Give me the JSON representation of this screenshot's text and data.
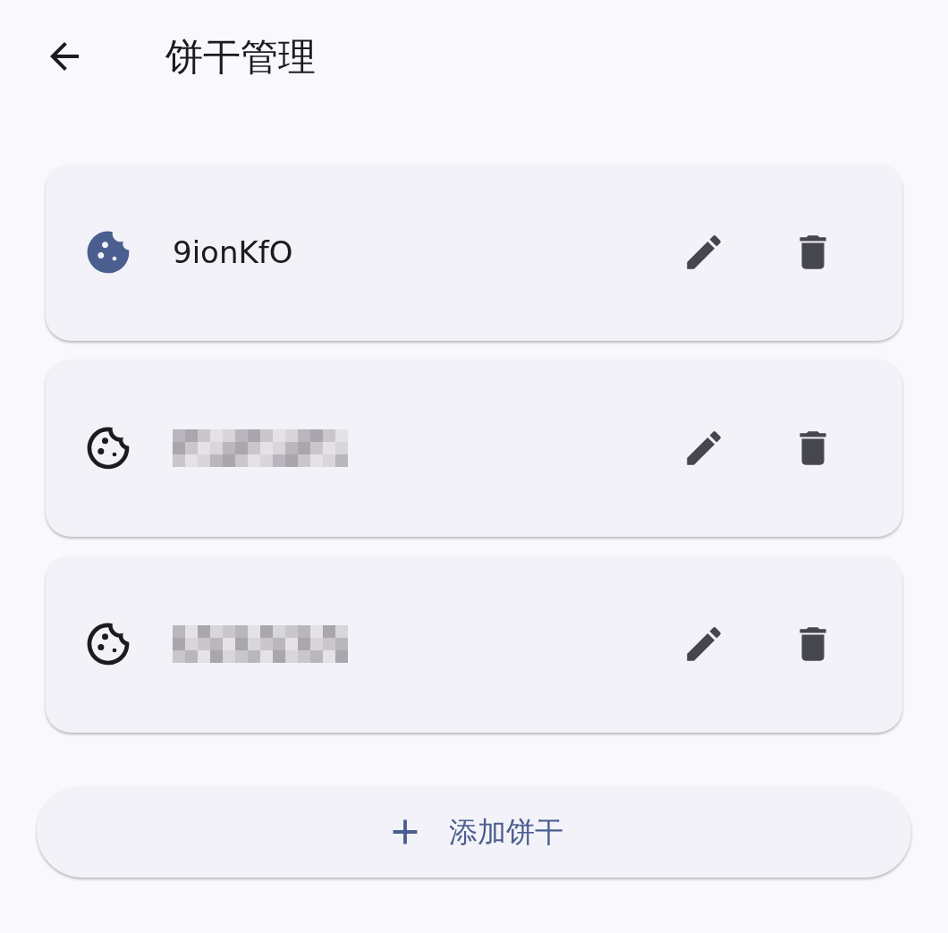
{
  "header": {
    "title": "饼干管理"
  },
  "cookies": [
    {
      "kind": "named",
      "name": "9ionKfO",
      "selected": true
    },
    {
      "kind": "redacted",
      "selected": false
    },
    {
      "kind": "redacted",
      "selected": false
    }
  ],
  "add_button": {
    "label": "添加饼干"
  }
}
